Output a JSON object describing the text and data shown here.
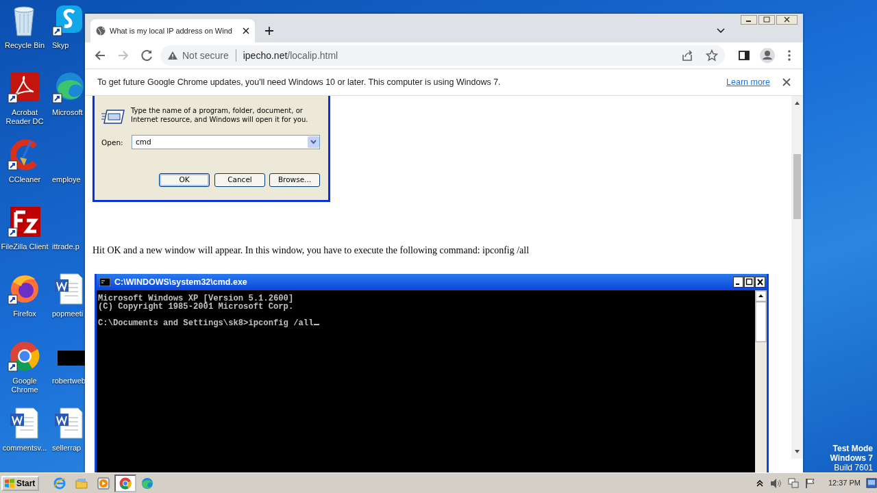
{
  "desktop_icons": [
    {
      "label": "Recycle Bin",
      "kind": "recycle"
    },
    {
      "label": "Skyp",
      "kind": "skype"
    },
    {
      "label": "Acrobat Reader DC",
      "kind": "acrobat"
    },
    {
      "label": "Microsoft",
      "kind": "edge"
    },
    {
      "label": "CCleaner",
      "kind": "ccleaner"
    },
    {
      "label": "employe",
      "kind": "none"
    },
    {
      "label": "FileZilla Client",
      "kind": "filezilla"
    },
    {
      "label": "ittrade.p",
      "kind": "none"
    },
    {
      "label": "Firefox",
      "kind": "firefox"
    },
    {
      "label": "popmeeti",
      "kind": "word"
    },
    {
      "label": "Google Chrome",
      "kind": "chrome"
    },
    {
      "label": "robertweb",
      "kind": "black"
    },
    {
      "label": "commentsv...",
      "kind": "word"
    },
    {
      "label": "sellerrap",
      "kind": "word"
    }
  ],
  "browser": {
    "tab": {
      "title": "What is my local IP address on Wind",
      "selected": true
    },
    "address": {
      "security": "Not secure",
      "host": "ipecho.net",
      "path": "/localip.html"
    },
    "infobar": {
      "message": "To get future Google Chrome updates, you'll need Windows 10 or later. This computer is using Windows 7.",
      "link": "Learn more"
    }
  },
  "page": {
    "run_dialog": {
      "prompt": "Type the name of a program, folder, document, or Internet resource, and Windows will open it for you.",
      "open_label": "Open:",
      "value": "cmd",
      "buttons": [
        "OK",
        "Cancel",
        "Browse..."
      ]
    },
    "instruction": "Hit OK and a new window will appear. In this window, you have to execute the following command: ipconfig /all",
    "cmd": {
      "title": "C:\\WINDOWS\\system32\\cmd.exe",
      "lines": [
        {
          "text": "Microsoft Windows XP [Version 5.1.2600]",
          "kind": "output"
        },
        {
          "text": "(C) Copyright 1985-2001 Microsoft Corp.",
          "kind": "output"
        },
        {
          "text": "C:\\Documents and Settings\\sk8>ipconfig /all",
          "kind": "prompt"
        }
      ]
    }
  },
  "desktop_notice": [
    "Test Mode",
    "Windows 7",
    "Build 7601"
  ],
  "taskbar": {
    "start": "Start",
    "apps": [
      {
        "kind": "ie",
        "selected": false
      },
      {
        "kind": "explorer",
        "selected": false
      },
      {
        "kind": "media",
        "selected": false
      },
      {
        "kind": "chrome",
        "selected": true
      },
      {
        "kind": "edge",
        "selected": false
      }
    ],
    "clock": "12:37 PM"
  }
}
